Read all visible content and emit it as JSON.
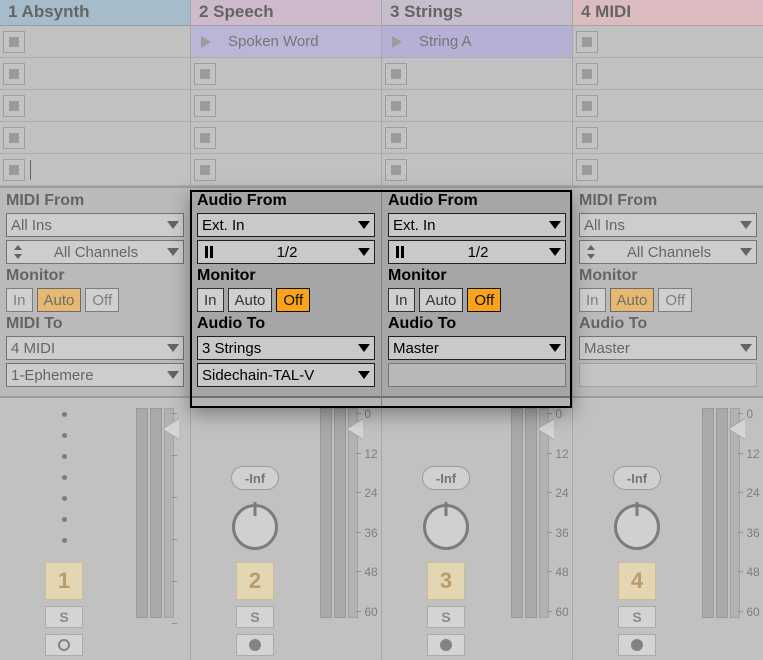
{
  "tracks": [
    {
      "header": "1 Absynth",
      "clips": [
        {
          "type": "stop"
        },
        {
          "type": "stop"
        },
        {
          "type": "stop"
        },
        {
          "type": "stop"
        },
        {
          "type": "stop-cursor"
        }
      ],
      "io": {
        "from_label": "MIDI From",
        "from_value": "All Ins",
        "chan_value": "All Channels",
        "chan_prefix": "updown",
        "monitor_label": "Monitor",
        "monitor": {
          "in": "In",
          "auto": "Auto",
          "off": "Off",
          "active": "auto"
        },
        "to_label": "MIDI To",
        "to_value": "4 MIDI",
        "sub_value": "1-Ephemere"
      },
      "mixer": {
        "vol": "",
        "number": "1",
        "solo": "S",
        "rec": "ring",
        "scale": [
          "",
          "",
          "",
          "",
          "",
          ""
        ]
      }
    },
    {
      "header": "2 Speech",
      "clips": [
        {
          "type": "play",
          "label": "Spoken Word",
          "color": "#a59ddb"
        },
        {
          "type": "stop"
        },
        {
          "type": "stop"
        },
        {
          "type": "stop"
        },
        {
          "type": "stop"
        }
      ],
      "io": {
        "from_label": "Audio From",
        "from_value": "Ext. In",
        "chan_value": "1/2",
        "chan_prefix": "bars",
        "monitor_label": "Monitor",
        "monitor": {
          "in": "In",
          "auto": "Auto",
          "off": "Off",
          "active": "off"
        },
        "to_label": "Audio To",
        "to_value": "3 Strings",
        "sub_value": "Sidechain-TAL-V"
      },
      "mixer": {
        "vol": "-Inf",
        "number": "2",
        "solo": "S",
        "rec": "dot",
        "scale": [
          "0",
          "12",
          "24",
          "36",
          "48",
          "60"
        ]
      }
    },
    {
      "header": "3 Strings",
      "clips": [
        {
          "type": "play",
          "label": "String A",
          "color": "#9e94d6"
        },
        {
          "type": "stop"
        },
        {
          "type": "stop"
        },
        {
          "type": "stop"
        },
        {
          "type": "stop"
        }
      ],
      "io": {
        "from_label": "Audio From",
        "from_value": "Ext. In",
        "chan_value": "1/2",
        "chan_prefix": "bars",
        "monitor_label": "Monitor",
        "monitor": {
          "in": "In",
          "auto": "Auto",
          "off": "Off",
          "active": "off"
        },
        "to_label": "Audio To",
        "to_value": "Master",
        "sub_value": ""
      },
      "mixer": {
        "vol": "-Inf",
        "number": "3",
        "solo": "S",
        "rec": "dot",
        "scale": [
          "0",
          "12",
          "24",
          "36",
          "48",
          "60"
        ]
      }
    },
    {
      "header": "4 MIDI",
      "clips": [
        {
          "type": "stop"
        },
        {
          "type": "stop"
        },
        {
          "type": "stop"
        },
        {
          "type": "stop"
        },
        {
          "type": "stop"
        }
      ],
      "io": {
        "from_label": "MIDI From",
        "from_value": "All Ins",
        "chan_value": "All Channels",
        "chan_prefix": "updown",
        "monitor_label": "Monitor",
        "monitor": {
          "in": "In",
          "auto": "Auto",
          "off": "Off",
          "active": "auto"
        },
        "to_label": "Audio To",
        "to_value": "Master",
        "sub_value": ""
      },
      "mixer": {
        "vol": "-Inf",
        "number": "4",
        "solo": "S",
        "rec": "dot",
        "scale": [
          "0",
          "12",
          "24",
          "36",
          "48",
          "60"
        ]
      }
    }
  ]
}
